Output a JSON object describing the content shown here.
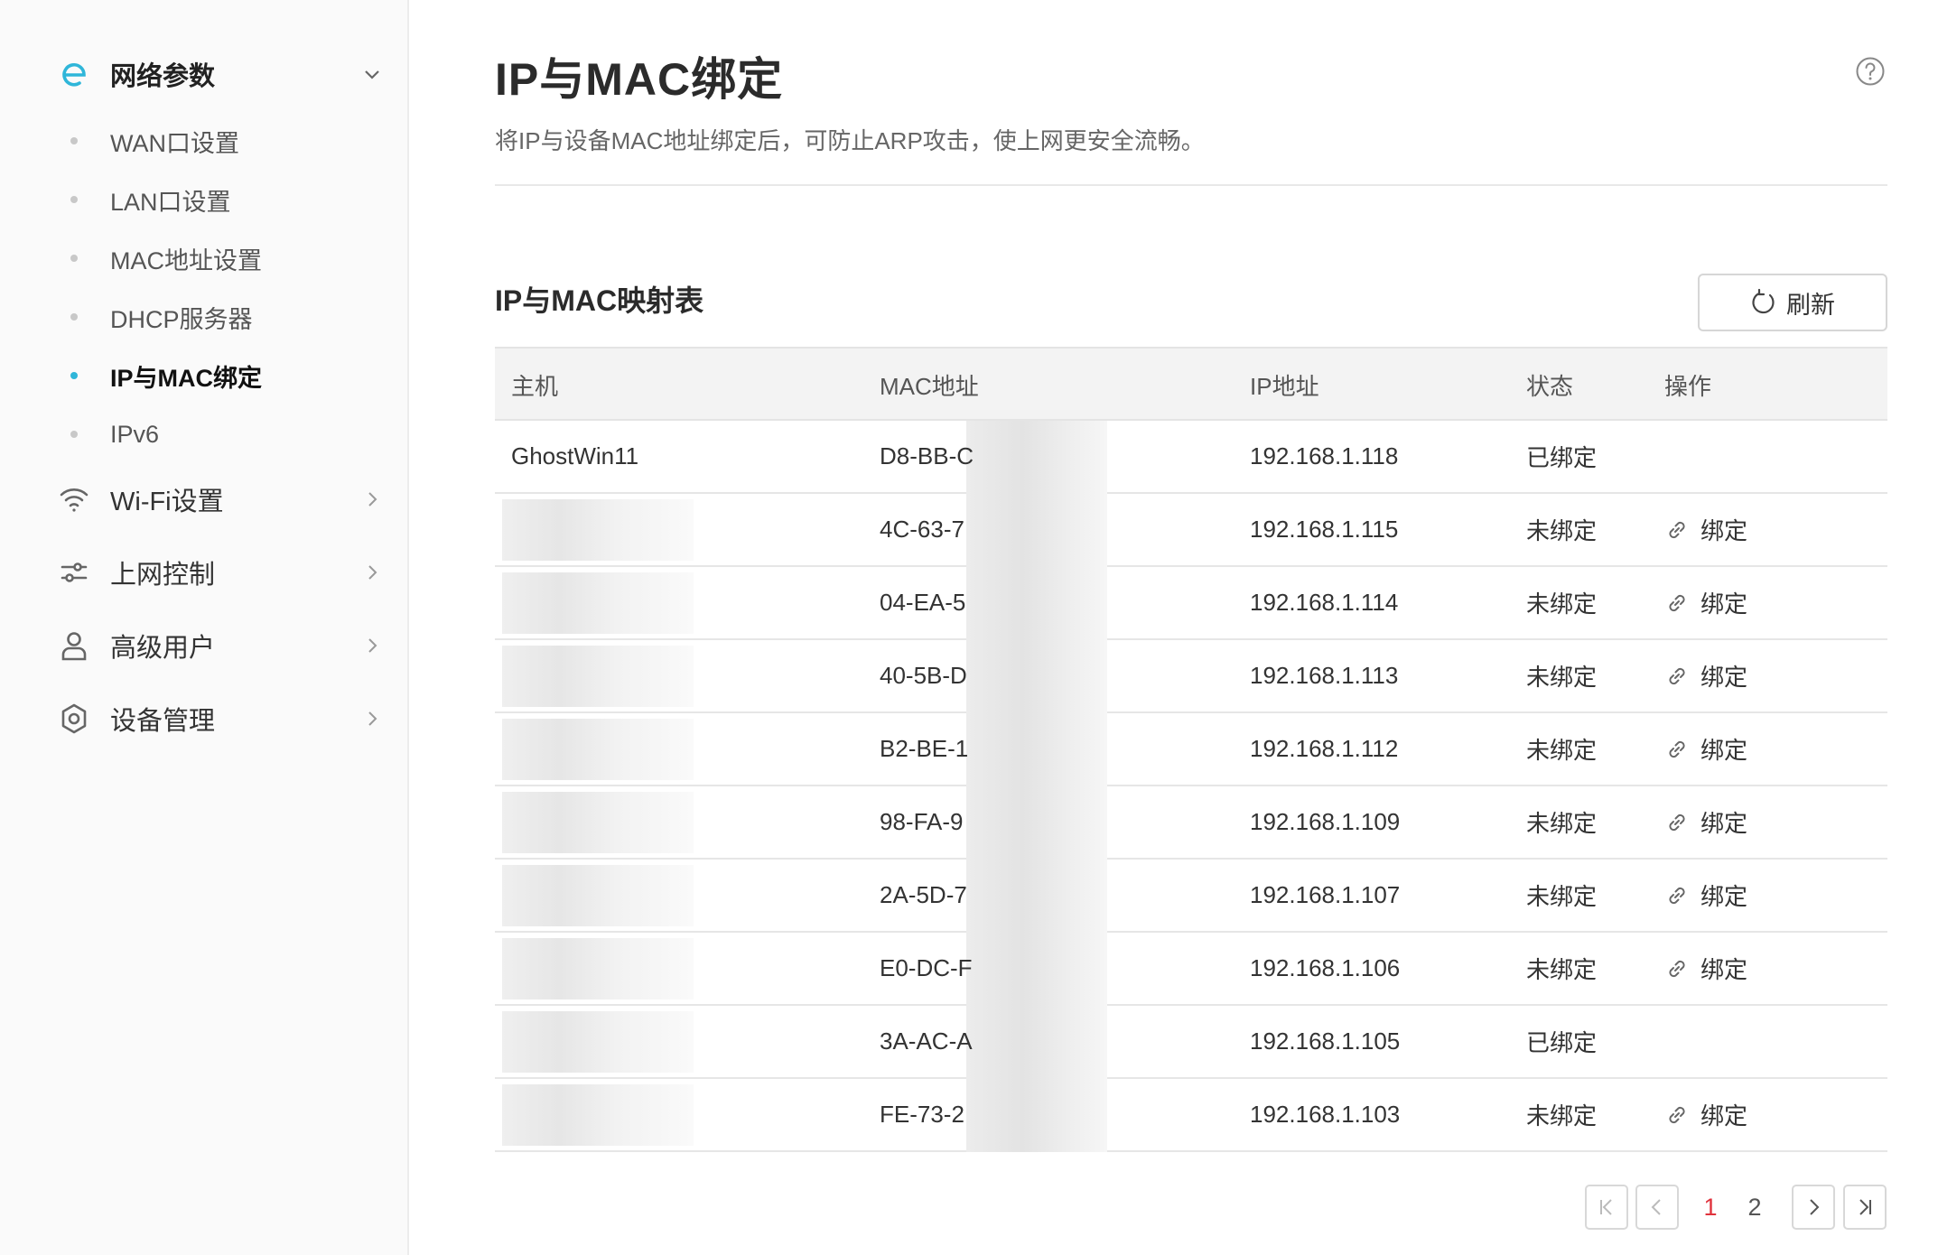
{
  "sidebar": {
    "groups": [
      {
        "label": "网络参数",
        "icon": "router-e-icon",
        "expanded": true
      },
      {
        "label": "Wi-Fi设置",
        "icon": "wifi-icon"
      },
      {
        "label": "上网控制",
        "icon": "sliders-icon"
      },
      {
        "label": "高级用户",
        "icon": "user-icon"
      },
      {
        "label": "设备管理",
        "icon": "settings-gear-icon"
      }
    ],
    "subitems": [
      {
        "label": "WAN口设置"
      },
      {
        "label": "LAN口设置"
      },
      {
        "label": "MAC地址设置"
      },
      {
        "label": "DHCP服务器"
      },
      {
        "label": "IP与MAC绑定",
        "active": true
      },
      {
        "label": "IPv6"
      }
    ]
  },
  "page": {
    "title": "IP与MAC绑定",
    "description": "将IP与设备MAC地址绑定后，可防止ARP攻击，使上网更安全流畅。"
  },
  "section": {
    "title": "IP与MAC映射表",
    "refresh_label": "刷新"
  },
  "table": {
    "headers": {
      "host": "主机",
      "mac": "MAC地址",
      "ip": "IP地址",
      "status": "状态",
      "op": "操作"
    },
    "rows": [
      {
        "host": "GhostWin11",
        "mac": "D8-BB-C",
        "ip": "192.168.1.118",
        "status": "已绑定",
        "op": ""
      },
      {
        "host": "",
        "mac": "4C-63-7",
        "ip": "192.168.1.115",
        "status": "未绑定",
        "op": "绑定"
      },
      {
        "host": "",
        "mac": "04-EA-5",
        "ip": "192.168.1.114",
        "status": "未绑定",
        "op": "绑定"
      },
      {
        "host": "",
        "mac": "40-5B-D",
        "ip": "192.168.1.113",
        "status": "未绑定",
        "op": "绑定"
      },
      {
        "host": "",
        "mac": "B2-BE-1",
        "ip": "192.168.1.112",
        "status": "未绑定",
        "op": "绑定"
      },
      {
        "host": "",
        "mac": "98-FA-9",
        "ip": "192.168.1.109",
        "status": "未绑定",
        "op": "绑定"
      },
      {
        "host": "",
        "mac": "2A-5D-7",
        "ip": "192.168.1.107",
        "status": "未绑定",
        "op": "绑定"
      },
      {
        "host": "",
        "mac": "E0-DC-F",
        "ip": "192.168.1.106",
        "status": "未绑定",
        "op": "绑定"
      },
      {
        "host": "",
        "mac": "3A-AC-A",
        "ip": "192.168.1.105",
        "status": "已绑定",
        "op": ""
      },
      {
        "host": "",
        "mac": "FE-73-2",
        "ip": "192.168.1.103",
        "status": "未绑定",
        "op": "绑定"
      }
    ]
  },
  "pagination": {
    "pages": [
      "1",
      "2"
    ],
    "current": "1"
  },
  "colors": {
    "accent": "#2fb6d9",
    "current_page": "#e0323c"
  }
}
